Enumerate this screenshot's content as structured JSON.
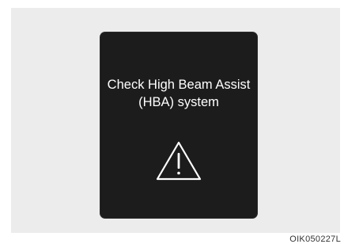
{
  "display": {
    "message_line1": "Check High Beam Assist",
    "message_line2": "(HBA) system",
    "icon": "warning-triangle-icon"
  },
  "caption": "OIK050227L",
  "colors": {
    "screen": "#1c1c1c",
    "text": "#ffffff",
    "background": "#ececec"
  }
}
